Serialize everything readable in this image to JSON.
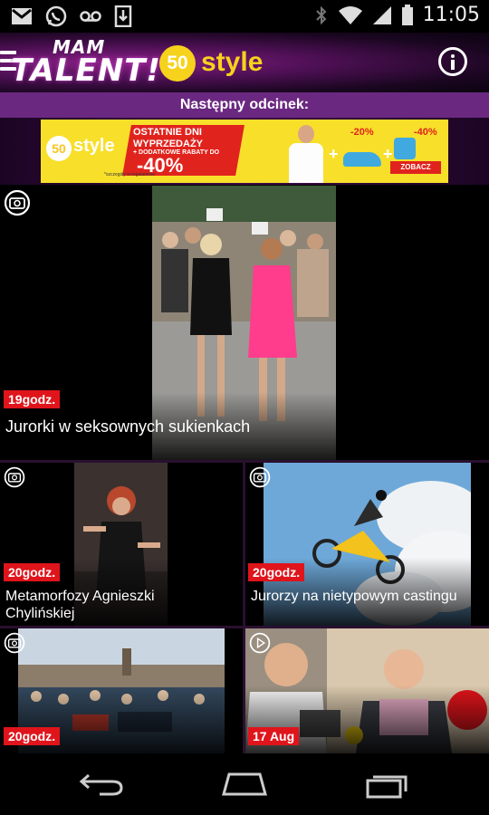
{
  "status_bar": {
    "time": "11:05",
    "left_icons": [
      "gmail-icon",
      "whatsapp-icon",
      "voicemail-icon",
      "download-icon"
    ],
    "right_icons": [
      "bluetooth-icon",
      "wifi-icon",
      "signal-icon",
      "battery-icon"
    ]
  },
  "app_bar": {
    "logo_top": "MAM",
    "logo_main": "TALENT!",
    "sponsor_number": "50",
    "sponsor_word": "style",
    "icons": [
      "menu-icon",
      "info-icon"
    ]
  },
  "next_episode": {
    "label": "Następny odcinek:"
  },
  "ad_banner": {
    "logo_number": "50",
    "logo_word": "style",
    "line1": "OSTATNIE DNI",
    "line2": "WYPRZEDAŻY",
    "line3": "+ DODATKOWE RABATY DO",
    "line4": "-40%",
    "footnote": "*szczegóły w regulaminie",
    "discount1": "-20%",
    "discount2": "-40%",
    "cta": "ZOBACZ",
    "colors": {
      "background": "#f8df2a",
      "accent": "#e1231d",
      "product": "#3fa9e0"
    }
  },
  "tiles": [
    {
      "type": "photo-icon",
      "time": "19godz.",
      "title": "Jurorki w seksownych sukienkach"
    },
    {
      "type": "photo-icon",
      "time": "20godz.",
      "title": "Metamorfozy Agnieszki Chylińskiej"
    },
    {
      "type": "photo-icon",
      "time": "20godz.",
      "title": "Jurorzy na nietypowym castingu"
    },
    {
      "type": "photo-icon",
      "time": "20godz.",
      "title": ""
    },
    {
      "type": "play-icon",
      "time": "17 Aug",
      "title": ""
    }
  ],
  "nav_bar": {
    "icons": [
      "back-icon",
      "home-icon",
      "recents-icon"
    ]
  },
  "colors": {
    "header_purple": "#6b2880",
    "time_badge_red": "#e0141b",
    "brand_yellow": "#f7d21c"
  }
}
